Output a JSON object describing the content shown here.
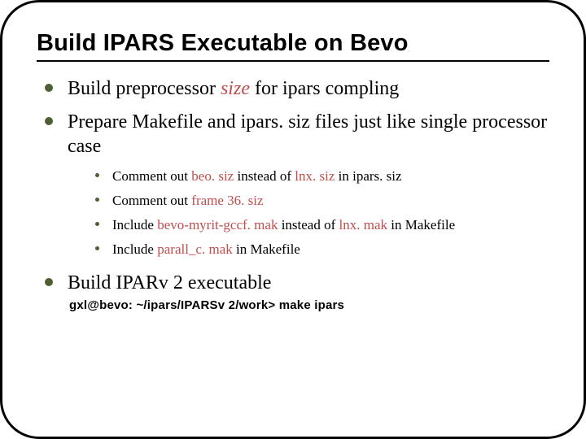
{
  "title": "Build IPARS Executable on Bevo",
  "bullets": {
    "b1_pre": "Build preprocessor ",
    "b1_em": "size",
    "b1_post": " for ipars compling",
    "b2": "Prepare Makefile and ipars. siz files just like single processor case",
    "b3": "Build IPARv 2 executable"
  },
  "sub": {
    "s1_a": "Comment out ",
    "s1_b": "beo. siz",
    "s1_c": " instead of  ",
    "s1_d": "lnx. siz",
    "s1_e": " in ipars. siz",
    "s2_a": "Comment out ",
    "s2_b": "frame 36. siz",
    "s3_a": "Include ",
    "s3_b": "bevo-myrit-gccf. mak",
    "s3_c": " instead of  ",
    "s3_d": "lnx. mak",
    "s3_e": " in Makefile",
    "s4_a": "Include ",
    "s4_b": "parall_c. mak",
    "s4_c": " in Makefile"
  },
  "command": "gxl@bevo: ~/ipars/IPARSv 2/work> make ipars"
}
